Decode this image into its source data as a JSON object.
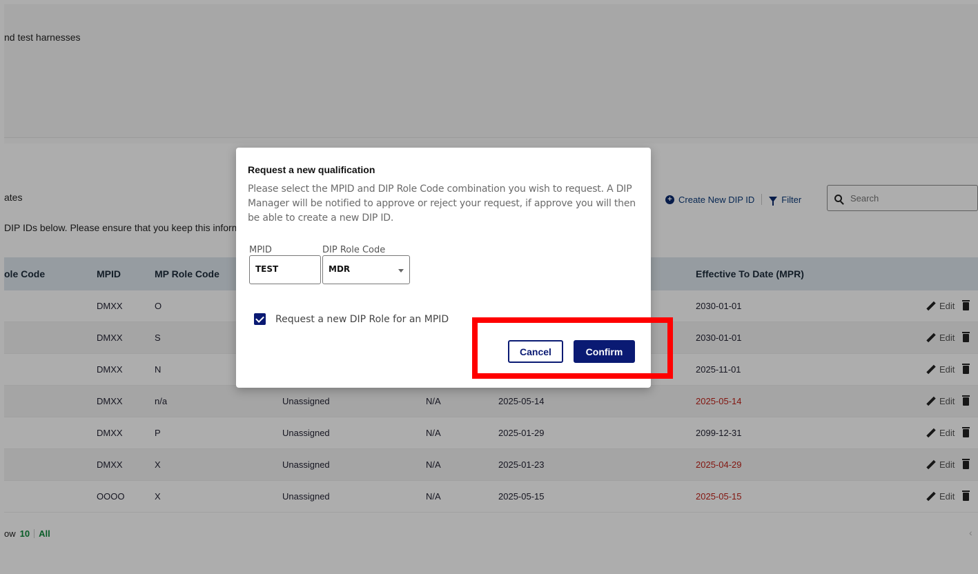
{
  "top_card": {
    "description": "nd test harnesses"
  },
  "content": {
    "subtitle": "ates",
    "info_text": "DIP IDs below. Please ensure that you keep this inform"
  },
  "toolbar": {
    "create_label": "Create New DIP ID",
    "filter_label": "Filter",
    "search_placeholder": "Search"
  },
  "table": {
    "headers": [
      "ole Code",
      "MPID",
      "MP Role Code",
      "Effective To Date (MPR)"
    ],
    "edit_label": "Edit",
    "rows": [
      {
        "mpid": "DMXX",
        "mp_role": "O",
        "status": "",
        "na": "",
        "from": "",
        "to": "2030-01-01",
        "to_red": false
      },
      {
        "mpid": "DMXX",
        "mp_role": "S",
        "status": "",
        "na": "",
        "from": "",
        "to": "2030-01-01",
        "to_red": false
      },
      {
        "mpid": "DMXX",
        "mp_role": "N",
        "status": "",
        "na": "",
        "from": "",
        "to": "2025-11-01",
        "to_red": false
      },
      {
        "mpid": "DMXX",
        "mp_role": "n/a",
        "status": "Unassigned",
        "na": "N/A",
        "from": "2025-05-14",
        "to": "2025-05-14",
        "to_red": true
      },
      {
        "mpid": "DMXX",
        "mp_role": "P",
        "status": "Unassigned",
        "na": "N/A",
        "from": "2025-01-29",
        "to": "2099-12-31",
        "to_red": false
      },
      {
        "mpid": "DMXX",
        "mp_role": "X",
        "status": "Unassigned",
        "na": "N/A",
        "from": "2025-01-23",
        "to": "2025-04-29",
        "to_red": true
      },
      {
        "mpid": "OOOO",
        "mp_role": "X",
        "status": "Unassigned",
        "na": "N/A",
        "from": "2025-05-15",
        "to": "2025-05-15",
        "to_red": true
      }
    ]
  },
  "pager": {
    "prefix": "ow",
    "size": "10",
    "all": "All"
  },
  "modal": {
    "title": "Request a new qualification",
    "description": "Please select the MPID and DIP Role Code combination you wish to request. A DIP Manager will be notified to approve or reject your request, if approve you will then be able to create a new DIP ID.",
    "mpid_label": "MPID",
    "mpid_value": "TEST",
    "role_label": "DIP Role Code",
    "role_value": "MDR",
    "checkbox_label": "Request a new DIP Role for an MPID",
    "cancel_label": "Cancel",
    "confirm_label": "Confirm"
  },
  "colors": {
    "primary": "#0a1a73",
    "highlight": "#ff0000",
    "date_warning": "#c0221a",
    "pager_accent": "#0f8a3c"
  }
}
